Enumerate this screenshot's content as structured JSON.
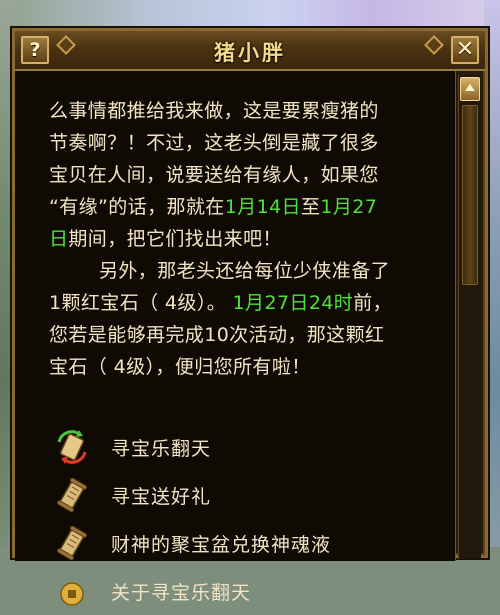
{
  "background": {
    "partial_text": "...."
  },
  "window": {
    "title": "猪小胖",
    "help_label": "?",
    "close_label": "✕"
  },
  "dialog": {
    "lines": [
      {
        "segments": [
          {
            "text": "么事情都推给我来做，这是要累瘦猪的",
            "hl": false
          }
        ]
      },
      {
        "segments": [
          {
            "text": "节奏啊？！不过，这老头倒是藏了很多",
            "hl": false
          }
        ]
      },
      {
        "segments": [
          {
            "text": "宝贝在人间，说要送给有缘人，如果您",
            "hl": false
          }
        ]
      },
      {
        "segments": [
          {
            "text": "“有缘”的话，那就在",
            "hl": false
          },
          {
            "text": "1月14日",
            "hl": true
          },
          {
            "text": "至",
            "hl": false
          },
          {
            "text": "1月27",
            "hl": true
          }
        ]
      },
      {
        "segments": [
          {
            "text": "日",
            "hl": true
          },
          {
            "text": "期间，把它们找出来吧！",
            "hl": false
          }
        ]
      },
      {
        "indent": true,
        "segments": [
          {
            "text": "另外，那老头还给每位少侠准备了",
            "hl": false
          }
        ]
      },
      {
        "segments": [
          {
            "text": "1颗红宝石（ 4级）。 ",
            "hl": false
          },
          {
            "text": "1月27日24时",
            "hl": true
          },
          {
            "text": "前，",
            "hl": false
          }
        ]
      },
      {
        "segments": [
          {
            "text": "您若是能够再完成10次活动，那这颗红",
            "hl": false
          }
        ]
      },
      {
        "segments": [
          {
            "text": "宝石（ 4级），便归您所有啦！",
            "hl": false
          }
        ]
      }
    ],
    "highlight_color": "#4fe23b"
  },
  "options": [
    {
      "label": "寻宝乐翻天",
      "icon": "scroll-exchange-icon"
    },
    {
      "label": "寻宝送好礼",
      "icon": "scroll-icon"
    },
    {
      "label": "财神的聚宝盆兑换神魂液",
      "icon": "scroll-icon"
    },
    {
      "label": "关于寻宝乐翻天",
      "icon": "coin-icon"
    }
  ]
}
